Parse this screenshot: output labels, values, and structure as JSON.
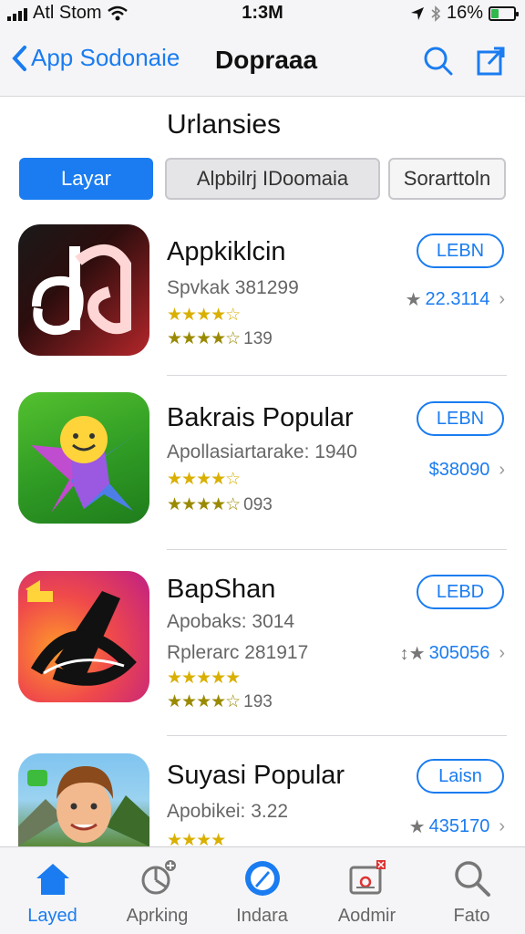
{
  "status_bar": {
    "carrier": "Atl Stom",
    "time": "1:3M",
    "battery": "16%",
    "battery_level": 0.16
  },
  "nav": {
    "back_label": "App Sodonaie",
    "title": "Dopraaa",
    "icons": [
      "chevron-left-icon",
      "search-icon",
      "share-icon"
    ]
  },
  "section": {
    "title": "Urlansies"
  },
  "filters": [
    {
      "label": "Layar",
      "active": true
    },
    {
      "label": "Alpbilrj IDoomaia",
      "active": false
    },
    {
      "label": "Sorarttoln",
      "active": false
    }
  ],
  "apps": [
    {
      "name": "Appkiklcin",
      "subtitle": "Spvkak 381299",
      "stars_top": "★★★★☆",
      "stars_bottom": "★★★★☆",
      "rating_count": "139",
      "button": "LEBN",
      "price": "22.3114",
      "price_star": "★",
      "icon": "script-letters-icon"
    },
    {
      "name": "Bakrais Popular",
      "subtitle": "Apollasiartarake: 1940",
      "stars_top": "★★★★☆",
      "stars_bottom": "★★★★☆",
      "rating_count": "093",
      "button": "LEBN",
      "price": "$38090",
      "price_star": "",
      "icon": "smiley-star-icon"
    },
    {
      "name": "BapShan",
      "subtitle": "Apobaks: 3014",
      "subtitle2": "Rplerarc 281917",
      "stars_top": "★★★★★",
      "stars_bottom": "★★★★☆",
      "rating_count": "193",
      "button": "LEBD",
      "price": "305056",
      "price_star": "↕★",
      "icon": "black-swirl-icon"
    },
    {
      "name": "Suyasi Popular",
      "subtitle": "Apobikei: 3.22",
      "stars_top": "★★★★",
      "stars_bottom": "",
      "rating_count": "",
      "button": "Laisn",
      "price": "435170",
      "price_star": "★",
      "icon": "avatar-man-icon"
    }
  ],
  "tabs": [
    {
      "label": "Layed",
      "icon": "home-icon",
      "active": true
    },
    {
      "label": "Aprking",
      "icon": "chart-icon",
      "active": false
    },
    {
      "label": "Indara",
      "icon": "compass-icon",
      "active": false
    },
    {
      "label": "Aodmir",
      "icon": "badge-box-icon",
      "active": false
    },
    {
      "label": "Fato",
      "icon": "search-icon",
      "active": false
    }
  ],
  "colors": {
    "accent": "#1a7cf0",
    "star": "#d9b000",
    "bar_bg": "#f5f5f7"
  }
}
